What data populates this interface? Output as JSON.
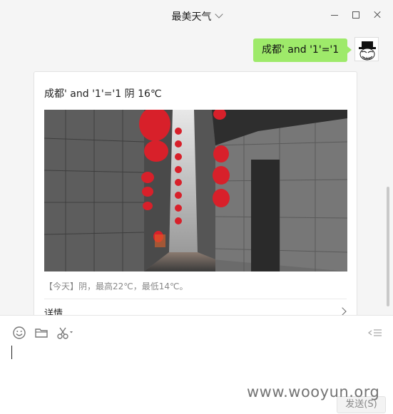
{
  "window": {
    "title": "最美天气"
  },
  "chat": {
    "outgoing_message": "成都' and '1'='1",
    "card": {
      "title": "成都' and '1'='1 阴 16℃",
      "description": "【今天】阴，最高22℃，最低14℃。",
      "details_label": "详情"
    }
  },
  "composer": {
    "send_label": "发送(S)"
  },
  "watermark": "www.wooyun.org",
  "colors": {
    "bubble": "#9eea6a",
    "background": "#f5f5f5"
  },
  "icons": [
    "chevron-down-icon",
    "minimize-icon",
    "maximize-icon",
    "close-icon",
    "emoji-icon",
    "folder-icon",
    "scissors-icon",
    "chat-history-icon",
    "chevron-right-icon"
  ]
}
